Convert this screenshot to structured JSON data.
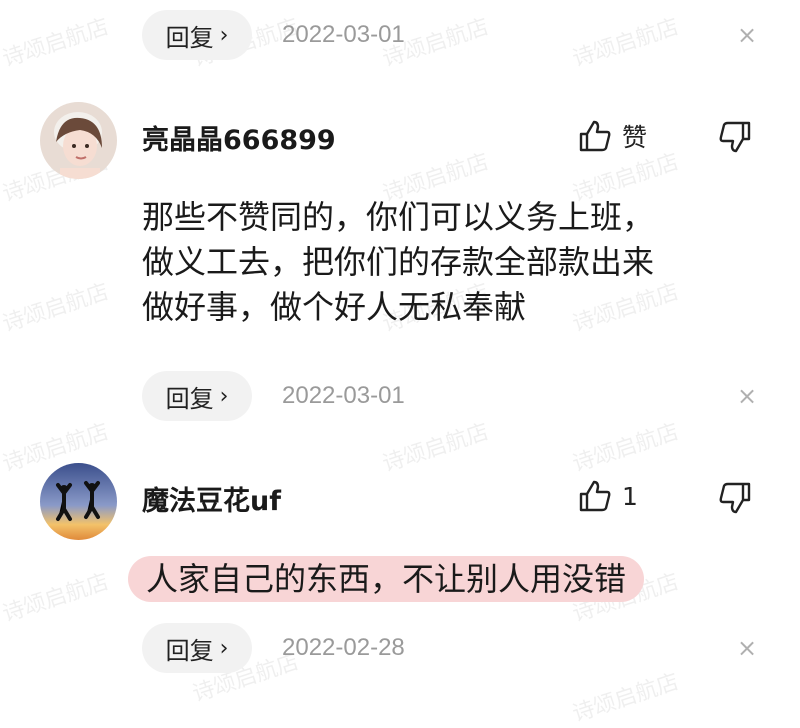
{
  "comments": [
    {
      "reply_label": "回复",
      "date": "2022-03-01",
      "close": "×"
    },
    {
      "username": "亮晶晶666899",
      "like_label": "赞",
      "text": [
        "那些不赞同的，你们可以义务上班，",
        "做义工去，把你们的存款全部款出来",
        "做好事，做个好人无私奉献"
      ],
      "reply_label": "回复",
      "date": "2022-03-01",
      "close": "×"
    },
    {
      "username": "魔法豆花uf",
      "like_count": "1",
      "text": "人家自己的东西，不让别人用没错",
      "reply_label": "回复",
      "date": "2022-02-28",
      "close": "×"
    }
  ],
  "watermark": "诗颂启航店",
  "colors": {
    "highlight": "#f8d5d6",
    "reply_bg": "#f2f2f2",
    "date": "#9a9a9a"
  }
}
